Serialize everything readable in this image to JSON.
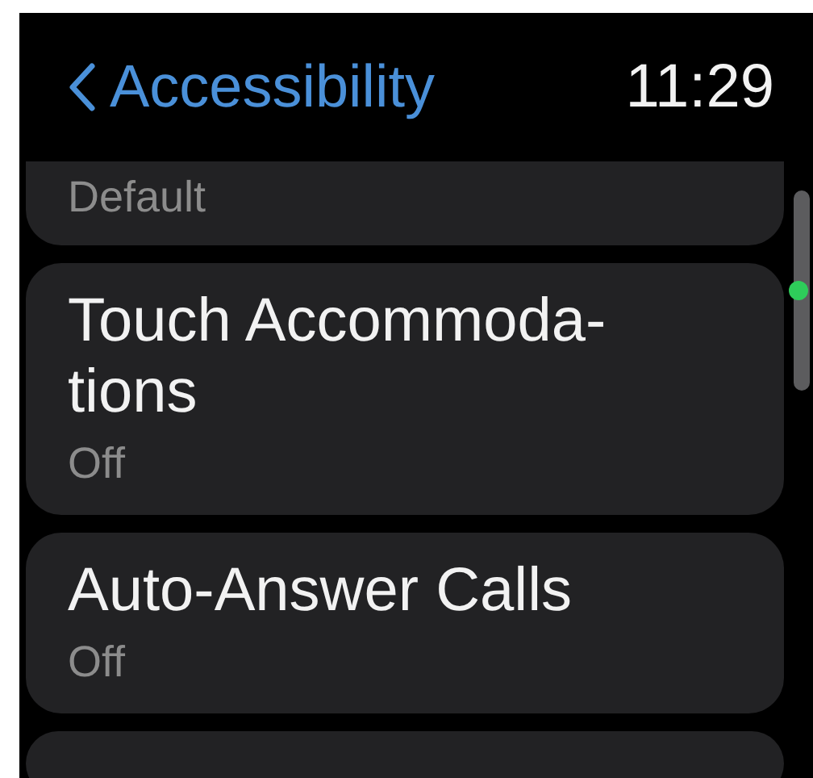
{
  "header": {
    "back_label": "Accessibility",
    "time": "11:29"
  },
  "items": [
    {
      "value": "Default"
    },
    {
      "title": "Touch Accommoda-tions",
      "value": "Off"
    },
    {
      "title": "Auto-Answer Calls",
      "value": "Off"
    }
  ]
}
